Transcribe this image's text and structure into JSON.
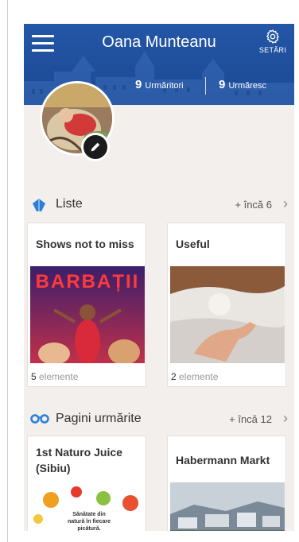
{
  "header": {
    "menu_icon": "hamburger-icon",
    "title": "Oana Munteanu",
    "settings_icon": "gear-icon",
    "settings_label": "SETĂRI",
    "followers_count": "9",
    "followers_label": "Urmăritori",
    "following_count": "9",
    "following_label": "Urmăresc"
  },
  "profile": {
    "edit_icon": "pencil-icon"
  },
  "lists": {
    "icon": "lists-icon",
    "title": "Liste",
    "more": "+ încă 6",
    "cards": [
      {
        "title": "Shows not to miss",
        "poster_text": "BARBAȚII",
        "count": "5",
        "count_label": "elemente"
      },
      {
        "title": "Useful",
        "count": "2",
        "count_label": "elemente"
      }
    ]
  },
  "pages": {
    "icon": "glasses-icon",
    "title": "Pagini urmărite",
    "more": "+ încă 12",
    "cards": [
      {
        "title": "1st Naturo Juice (Sibiu)",
        "ad_text": "Sănătate din natură în fiecare picătură."
      },
      {
        "title": "Habermann Markt"
      }
    ]
  },
  "colors": {
    "header_blue": "#1f4f9c",
    "background": "#f2efed",
    "section_icon_blue": "#2b7fd6"
  }
}
